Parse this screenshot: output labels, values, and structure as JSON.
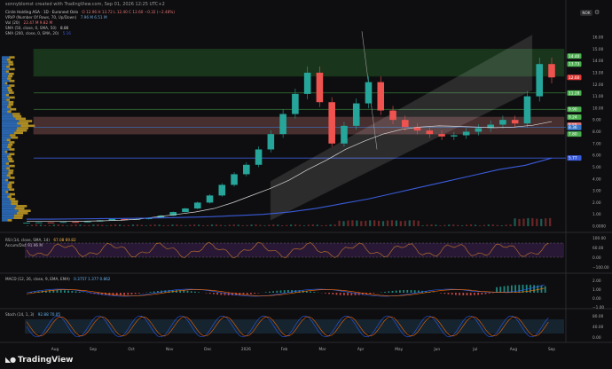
{
  "header": {
    "author_line": "sonnyblomst created with TradingView.com, Sep 01, 2026 12:25 UTC+2",
    "currency": "NOK"
  },
  "legend": {
    "symbol_line": "Circle Holding ASA · 1D · Euronext Oslo",
    "symbol_values": "O 12.96 H 13.72 L 12.40 C 12.60 −0.32 (−2.48%)",
    "vrvp_label": "VRVP (Number Of Rows, 70, Up/Down)",
    "vrvp_values": "7.96 M  6.51 M",
    "vol_label": "Vol (20)",
    "vol_values": "22.47 M  9.82 M",
    "sma50_label": "SMA (50, close, 0, SMA, 50)",
    "sma50_value": "8.86",
    "sma200_label": "SMA (200, close, 0, SMA, 20)",
    "sma200_value": "5.16"
  },
  "price_axis": [
    "16.00",
    "15.00",
    "14.00",
    "13.00",
    "12.00",
    "11.00",
    "10.00",
    "9.00",
    "8.00",
    "7.00",
    "6.00",
    "5.00",
    "4.00",
    "3.00",
    "2.00",
    "1.00",
    "0.0000"
  ],
  "price_tags": [
    {
      "label": "14.40",
      "color": "#4caf50"
    },
    {
      "label": "13.73",
      "color": "#4caf50"
    },
    {
      "label": "12.60",
      "color": "#e53935"
    },
    {
      "label": "11.28",
      "color": "#4caf50"
    },
    {
      "label": "9.90",
      "color": "#4caf50"
    },
    {
      "label": "9.24",
      "color": "#4caf50"
    },
    {
      "label": "8.55",
      "color": "#e57373"
    },
    {
      "label": "8.36",
      "color": "#3a78c6"
    },
    {
      "label": "7.80",
      "color": "#4caf50"
    },
    {
      "label": "5.77",
      "color": "#3a5bd9"
    }
  ],
  "x_axis": [
    "Aug",
    "Sep",
    "Oct",
    "Nov",
    "Dec",
    "2026",
    "Feb",
    "Mar",
    "Apr",
    "May",
    "Jun",
    "Jul",
    "Aug",
    "Sep"
  ],
  "rsi": {
    "label": "RSI (14, close, SMA, 14)",
    "values": "67.08  69.82",
    "sub": "Accum/Dist  91.96 M",
    "axis": [
      "100.00",
      "60.00",
      "0.00",
      "−100.00"
    ]
  },
  "macd": {
    "label": "MACD (12, 26, close, 9, EMA, EMA)",
    "values": "0.3757  1.377  0.862",
    "axis": [
      "2.00",
      "1.00",
      "0.00",
      "−1.00"
    ]
  },
  "stoch": {
    "label": "Stoch (14, 1, 3)",
    "values": "92.88  70.05",
    "axis": [
      "80.00",
      "40.00",
      "0.00"
    ]
  },
  "branding": "TradingView",
  "chart_data": {
    "type": "line",
    "title": "Circle Holding ASA · 1D · Euronext Oslo",
    "currency": "NOK",
    "ylim": [
      0,
      16
    ],
    "x_months": [
      "Aug",
      "Sep",
      "Oct",
      "Nov",
      "Dec",
      "2026",
      "Feb",
      "Mar",
      "Apr",
      "May",
      "Jun",
      "Jul",
      "Aug",
      "Sep"
    ],
    "series": [
      {
        "name": "Close",
        "values": [
          0.3,
          0.32,
          0.3,
          0.35,
          0.33,
          0.4,
          0.5,
          0.6,
          0.55,
          0.6,
          0.7,
          0.9,
          1.2,
          1.5,
          2.0,
          2.6,
          3.5,
          4.4,
          5.2,
          6.5,
          7.8,
          9.5,
          11.2,
          13.0,
          10.5,
          7.0,
          8.5,
          10.4,
          12.2,
          9.8,
          9.0,
          8.4,
          8.1,
          7.8,
          7.6,
          7.7,
          8.0,
          8.3,
          8.6,
          9.0,
          8.7,
          11.0,
          13.73,
          12.6
        ]
      },
      {
        "name": "SMA 50",
        "values": [
          0.4,
          0.4,
          0.4,
          0.42,
          0.45,
          0.5,
          0.6,
          0.8,
          1.0,
          1.2,
          1.5,
          2.0,
          2.6,
          3.2,
          3.9,
          4.8,
          5.6,
          6.5,
          7.2,
          7.8,
          8.2,
          8.4,
          8.5,
          8.45,
          8.4,
          8.35,
          8.4,
          8.55,
          8.86
        ]
      },
      {
        "name": "SMA 200",
        "values": [
          0.6,
          0.6,
          0.62,
          0.64,
          0.66,
          0.7,
          0.75,
          0.8,
          0.9,
          1.0,
          1.2,
          1.5,
          1.9,
          2.3,
          2.8,
          3.3,
          3.8,
          4.3,
          4.8,
          5.16,
          5.77
        ]
      }
    ],
    "zones": [
      {
        "name": "resistance",
        "from": 12.7,
        "to": 15.0,
        "color": "#2e7d32"
      },
      {
        "name": "range",
        "from": 7.8,
        "to": 9.24,
        "color": "#b26a6a"
      }
    ]
  }
}
